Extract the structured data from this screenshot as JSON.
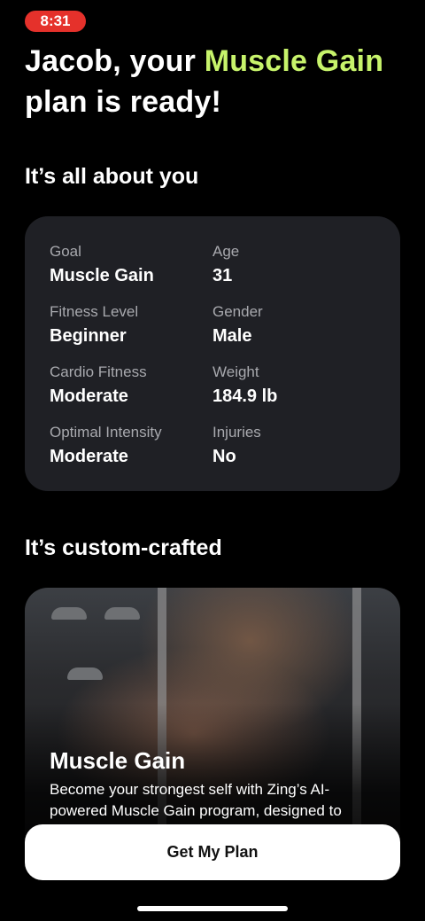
{
  "status": {
    "time": "8:31"
  },
  "header": {
    "line1_prefix": "Jacob, your ",
    "line1_accent": "Muscle Gain",
    "line2": "plan is ready!"
  },
  "profile": {
    "section_title": "It’s all about you",
    "fields": [
      {
        "label": "Goal",
        "value": "Muscle Gain"
      },
      {
        "label": "Age",
        "value": "31"
      },
      {
        "label": "Fitness Level",
        "value": "Beginner"
      },
      {
        "label": "Gender",
        "value": "Male"
      },
      {
        "label": "Cardio Fitness",
        "value": "Moderate"
      },
      {
        "label": "Weight",
        "value": "184.9 lb"
      },
      {
        "label": "Optimal Intensity",
        "value": "Moderate"
      },
      {
        "label": "Injuries",
        "value": "No"
      }
    ]
  },
  "custom": {
    "section_title": "It’s custom-crafted",
    "card_title": "Muscle Gain",
    "card_description": "Become your strongest self with Zing’s AI-powered Muscle Gain program, designed to"
  },
  "cta": {
    "label": "Get My Plan"
  },
  "colors": {
    "accent": "#c7f36b",
    "status_pill": "#e5312b",
    "card_bg": "#1f2025"
  }
}
